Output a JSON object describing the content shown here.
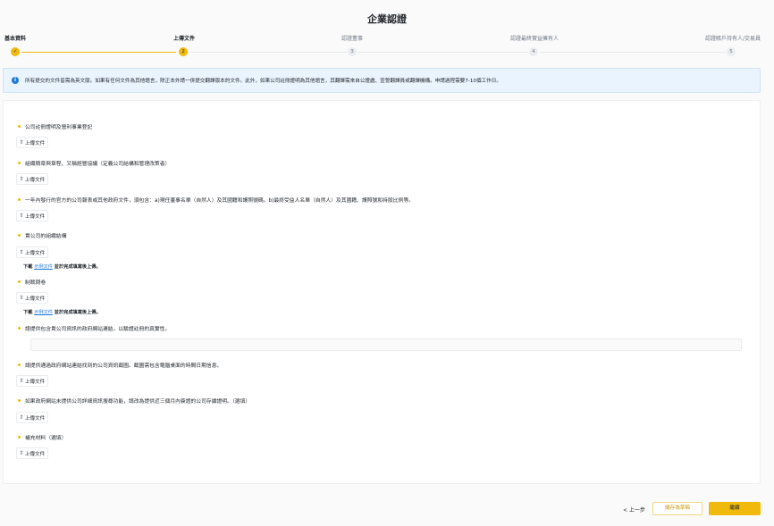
{
  "title": "企業認證",
  "steps": [
    {
      "label": "基本資料",
      "marker": "✓",
      "state": "done"
    },
    {
      "label": "上傳文件",
      "marker": "2",
      "state": "current"
    },
    {
      "label": "認證董事",
      "marker": "3",
      "state": "pending"
    },
    {
      "label": "認證最終實益擁有人",
      "marker": "4",
      "state": "pending"
    },
    {
      "label": "認證賬戶持有人/交易員",
      "marker": "5",
      "state": "pending"
    }
  ],
  "notice": {
    "icon": "info-icon",
    "text": "所有提交的文件皆需為英文版。如果有任何文件為其他語言，除正本外請一併提交翻譯版本的文件。此外，如果公司註冊證明為其他語言，其翻譯需來自公證處、宣誓翻譯員或翻譯機構。申請過程需要7-10個工作日。"
  },
  "upload_label": "上傳文件",
  "fields": [
    {
      "label": "公司註冊證明及營利事業登記"
    },
    {
      "label": "組織簡章與章程、又稱經營協議（定義公司結構和管理改策者）"
    },
    {
      "label": "一年內發行的官方的公司報表或其他政府文件，須包含：a)現任董事名單（自然人）及其國籍和護照號碼。b)最終受益人名單（自然人）及其國籍、護照號和持股比例等。"
    },
    {
      "label": "貴公司的組織結構",
      "hint": {
        "prefix": "下載",
        "link": "示例文件",
        "suffix": "並於完成填寫後上傳。"
      }
    },
    {
      "label": "制裁問卷",
      "hint": {
        "prefix": "下載",
        "link": "示例文件",
        "suffix": "並於完成填寫後上傳。"
      }
    },
    {
      "label": "請提供包含貴公司資訊的政府網站連結，以驗證註冊的真實性。",
      "input": {
        "value": "",
        "placeholder": ""
      }
    },
    {
      "label": "請提供通過政府網站連結找到的公司資訊截圖。截圖需包含電腦桌面的時間日期信息。"
    },
    {
      "label": "如果政府網站未提供公司詳細資訊搜尋功能，請改為提供近三個月內簽證的公司存續證明。（選填）"
    },
    {
      "label": "補充材料（選填）"
    }
  ],
  "footer": {
    "back": "< 上一步",
    "save": "儲存為草稿",
    "continue": "繼續"
  },
  "colors": {
    "accent": "#f0b90b",
    "info": "#1e79e0",
    "notice_bg": "#eaf4fe"
  }
}
